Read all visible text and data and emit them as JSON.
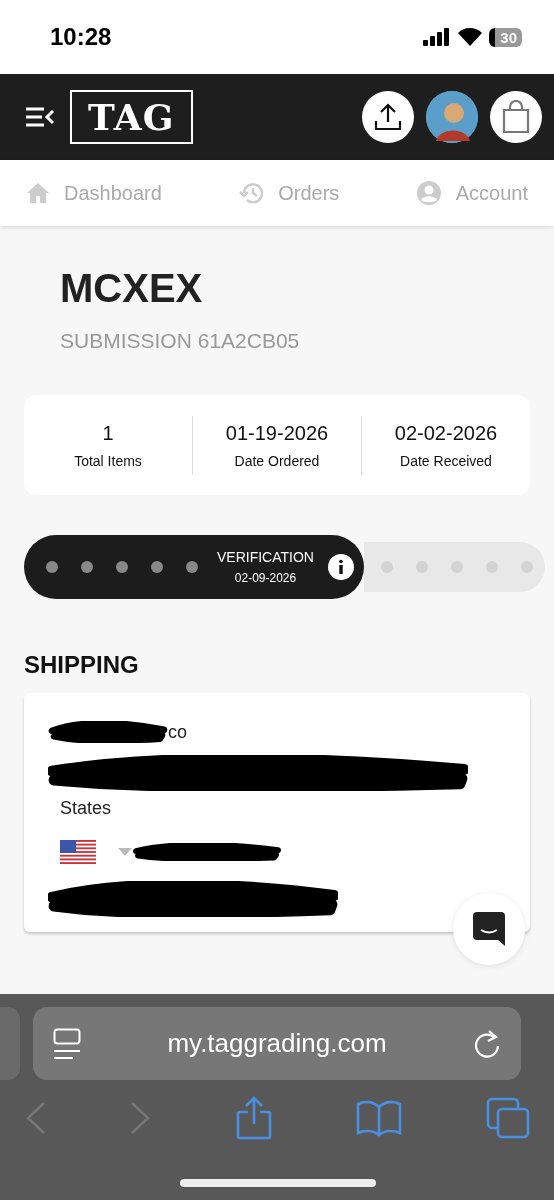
{
  "status_bar": {
    "time": "10:28",
    "battery": "30"
  },
  "header": {
    "logo": "TAG"
  },
  "nav": [
    {
      "label": "Dashboard",
      "kind": "home"
    },
    {
      "label": "Orders",
      "kind": "history"
    },
    {
      "label": "Account",
      "kind": "account"
    }
  ],
  "submission": {
    "title": "MCXEX",
    "subtitle": "SUBMISSION 61A2CB05"
  },
  "stats": [
    {
      "value": "1",
      "label": "Total Items"
    },
    {
      "value": "01-19-2026",
      "label": "Date Ordered"
    },
    {
      "value": "02-02-2026",
      "label": "Date Received"
    }
  ],
  "progress": [
    {
      "kind": "done"
    },
    {
      "kind": "done"
    },
    {
      "kind": "done"
    },
    {
      "kind": "done"
    },
    {
      "kind": "done"
    },
    {
      "kind": "current",
      "label": "VERIFICATION",
      "date": "02-09-2026"
    },
    {
      "kind": "pending"
    },
    {
      "kind": "pending"
    },
    {
      "kind": "pending"
    },
    {
      "kind": "pending"
    },
    {
      "kind": "pending"
    }
  ],
  "shipping": {
    "heading": "SHIPPING",
    "name_fragment": "co",
    "country_fragment": "States"
  },
  "browser": {
    "url": "my.taggrading.com"
  }
}
